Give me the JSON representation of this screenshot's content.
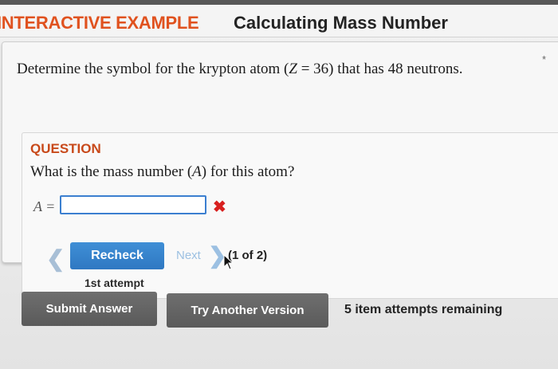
{
  "header": {
    "tag": "INTERACTIVE EXAMPLE",
    "title": "Calculating Mass Number"
  },
  "problem": {
    "prefix": "Determine the symbol for the krypton atom (",
    "z_symbol": "Z",
    "z_value": " = 36) that has 48 neutrons.",
    "asterisk": "*"
  },
  "question": {
    "label": "QUESTION",
    "text_prefix": "What is the mass number (",
    "a_symbol": "A",
    "text_suffix": ") for this atom?",
    "answer_label": "A =",
    "answer_value": "",
    "answer_status_icon": "x-mark-icon",
    "answer_status_color": "#d8201f"
  },
  "navigation": {
    "prev_glyph": "❮",
    "recheck_label": "Recheck",
    "next_label": "Next",
    "next_glyph": "❯",
    "counter": "(1 of 2)",
    "attempt_label": "1st attempt"
  },
  "actions": {
    "submit_label": "Submit Answer",
    "try_another_label": "Try Another Version",
    "remaining_text": "5 item attempts remaining"
  },
  "colors": {
    "accent_orange": "#e0521f",
    "primary_blue": "#3382cc",
    "button_gray": "#626262"
  }
}
